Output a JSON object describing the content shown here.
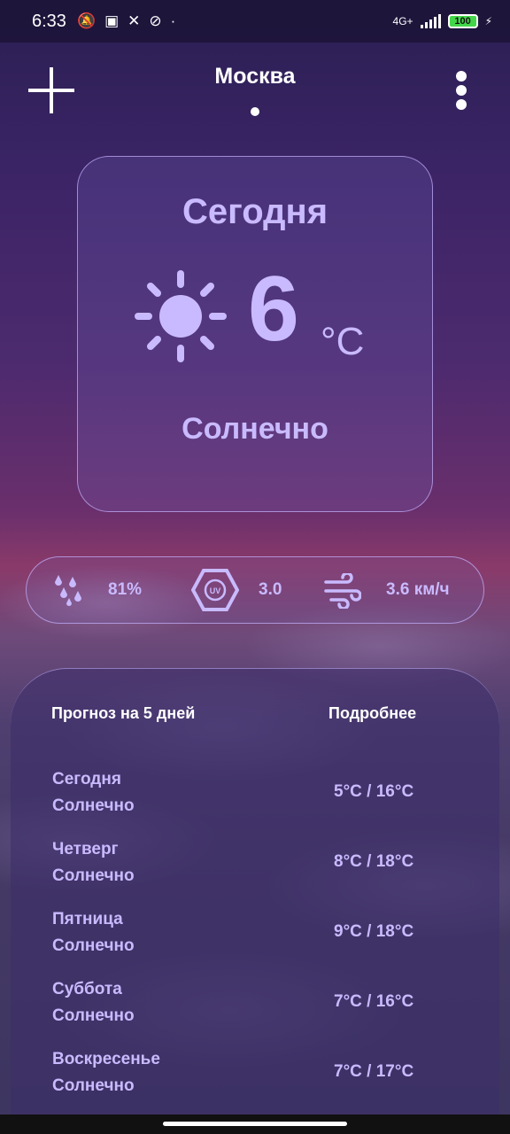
{
  "status_bar": {
    "time": "6:33",
    "network": "4G+",
    "battery": "100"
  },
  "header": {
    "city": "Москва"
  },
  "today": {
    "title": "Сегодня",
    "temperature": "6",
    "unit": "°C",
    "condition": "Солнечно",
    "icon": "sun-icon"
  },
  "stats": {
    "humidity": "81%",
    "uv": "3.0",
    "wind": "3.6 км/ч"
  },
  "forecast": {
    "title": "Прогноз на 5 дней",
    "more": "Подробнее",
    "days": [
      {
        "day": "Сегодня",
        "condition": "Солнечно",
        "range": "5°C / 16°C"
      },
      {
        "day": "Четверг",
        "condition": "Солнечно",
        "range": "8°C / 18°C"
      },
      {
        "day": "Пятница",
        "condition": "Солнечно",
        "range": "9°C / 18°C"
      },
      {
        "day": "Суббота",
        "condition": "Солнечно",
        "range": "7°C / 16°C"
      },
      {
        "day": "Воскресенье",
        "condition": "Солнечно",
        "range": "7°C / 17°C"
      }
    ]
  },
  "colors": {
    "accent": "#c9baff",
    "border": "#c8b4ff"
  }
}
